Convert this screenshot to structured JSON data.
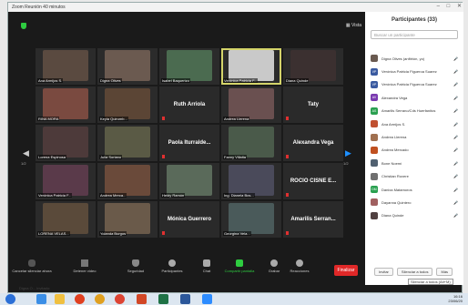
{
  "window": {
    "title": "Zoom Reunión 40 minutos"
  },
  "meeting": {
    "view_label": "Vista",
    "page_left": "1/2",
    "page_right": "1/2"
  },
  "tiles": [
    {
      "name": "Ana Armijos S.",
      "type": "video",
      "color": "#5a4a40"
    },
    {
      "name": "Digna Olives",
      "type": "video",
      "color": "#6b5a50"
    },
    {
      "name": "Isabel Baquerizo",
      "type": "video",
      "color": "#4b6b50"
    },
    {
      "name": "Verónica Patricia F...",
      "type": "video",
      "color": "#c9c9c9"
    },
    {
      "name": "Diana Quinde",
      "type": "video",
      "color": "#3b3030"
    },
    {
      "name": "RINA MORA",
      "type": "video",
      "color": "#7a4a40"
    },
    {
      "name": "Keyla Quirumb...",
      "type": "video",
      "color": "#5b4535"
    },
    {
      "name": "",
      "type": "name",
      "title": "Ruth Arriola"
    },
    {
      "name": "Andrea Llerena",
      "type": "video",
      "color": "#6a5050"
    },
    {
      "name": "",
      "type": "name",
      "title": "Taty"
    },
    {
      "name": "Lorena Espinosa",
      "type": "video",
      "color": "#4d3a3a"
    },
    {
      "name": "Julia Soriano",
      "type": "video",
      "color": "#5a5a45"
    },
    {
      "name": "",
      "type": "name",
      "title": "Paola Iturralde..."
    },
    {
      "name": "Fanny Villalta",
      "type": "video",
      "color": "#4a5a4a"
    },
    {
      "name": "",
      "type": "name",
      "title": "Alexandra Vega"
    },
    {
      "name": "Verónica Patricia F...",
      "type": "video",
      "color": "#5a3a4a"
    },
    {
      "name": "Andrea Merca...",
      "type": "video",
      "color": "#6a4a3a"
    },
    {
      "name": "Heidy Ramón",
      "type": "video",
      "color": "#5a6a5a"
    },
    {
      "name": "Ing. Dianela Bos...",
      "type": "video",
      "color": "#4a4a5a"
    },
    {
      "name": "",
      "type": "name",
      "title": "ROCIO CISNE E..."
    },
    {
      "name": "LORENA VELAS...",
      "type": "video",
      "color": "#5a4a3a"
    },
    {
      "name": "Yolanda Burgos",
      "type": "video",
      "color": "#6a5a4a"
    },
    {
      "name": "",
      "type": "name",
      "title": "Mónica Guerrero"
    },
    {
      "name": "Georgina Vela...",
      "type": "video",
      "color": "#4a5a5a"
    },
    {
      "name": "",
      "type": "name",
      "title": "Amarilis Serran..."
    }
  ],
  "toolbar": {
    "mute": "Cancelar silenciar ahora",
    "video": "Detener video",
    "security": "Seguridad",
    "participants": "Participantes",
    "participants_count": "33",
    "chat": "Chat",
    "share": "Compartir pantalla",
    "record": "Grabar",
    "reactions": "Reacciones",
    "leave": "Finalizar"
  },
  "panel": {
    "title": "Participantes (33)",
    "search_placeholder": "Buscar un participante",
    "invite": "Invitar",
    "mute_all": "Silenciar a todos",
    "more": "Más",
    "tooltip": "Silenciar a todos (Alt+M)"
  },
  "participants": [
    {
      "initials": "",
      "name": "Digna Olives (anfitrión, yo)",
      "color": "#6a5a50"
    },
    {
      "initials": "VP",
      "name": "Verónica Patricia Figueroa Suarez",
      "color": "#3a5aa0"
    },
    {
      "initials": "VP",
      "name": "Verónica Patricia Figueroa Suarez",
      "color": "#3a5aa0"
    },
    {
      "initials": "AV",
      "name": "Alexandra Vega",
      "color": "#7a3ab0"
    },
    {
      "initials": "AS",
      "name": "Amarilis Serrano/Cds Huerfanitos",
      "color": "#2aa050"
    },
    {
      "initials": "",
      "name": "Ana Armijos S.",
      "color": "#c05030"
    },
    {
      "initials": "",
      "name": "Andrea Llerena",
      "color": "#a07050"
    },
    {
      "initials": "",
      "name": "Andrea Mercado",
      "color": "#c05020"
    },
    {
      "initials": "",
      "name": "Bone Noemí",
      "color": "#506070"
    },
    {
      "initials": "",
      "name": "Christian Rovere",
      "color": "#707070"
    },
    {
      "initials": "DM",
      "name": "Danixa Matamoros",
      "color": "#2aa050"
    },
    {
      "initials": "",
      "name": "Dayanna Quintero",
      "color": "#a06060"
    },
    {
      "initials": "",
      "name": "Diana Quinde",
      "color": "#504040"
    }
  ],
  "taskbar": {
    "time": "16:16",
    "date": "23/06/20"
  },
  "bottom_info": "Digna O...  Invitado:"
}
